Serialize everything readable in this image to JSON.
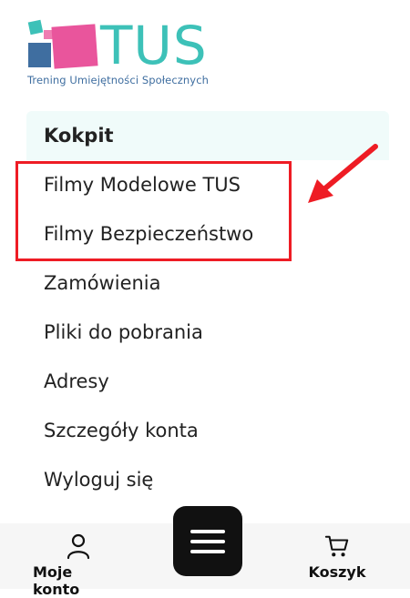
{
  "logo": {
    "word": "TUS",
    "tagline": "Trening Umiejętności Społecznych"
  },
  "menu": {
    "items": [
      {
        "label": "Kokpit",
        "active": true
      },
      {
        "label": "Filmy Modelowe TUS"
      },
      {
        "label": "Filmy Bezpieczeństwo"
      },
      {
        "label": "Zamówienia"
      },
      {
        "label": "Pliki do pobrania"
      },
      {
        "label": "Adresy"
      },
      {
        "label": "Szczegóły konta"
      },
      {
        "label": "Wyloguj się"
      }
    ]
  },
  "bottom_bar": {
    "account_label": "Moje konto",
    "cart_label": "Koszyk",
    "menu_icon": "hamburger-icon"
  },
  "colors": {
    "brand_teal": "#3dc1b8",
    "brand_pink": "#e9559c",
    "brand_blue": "#3f6ea0",
    "highlight_red": "#ee1c24",
    "active_bg": "#f0fbfa"
  }
}
